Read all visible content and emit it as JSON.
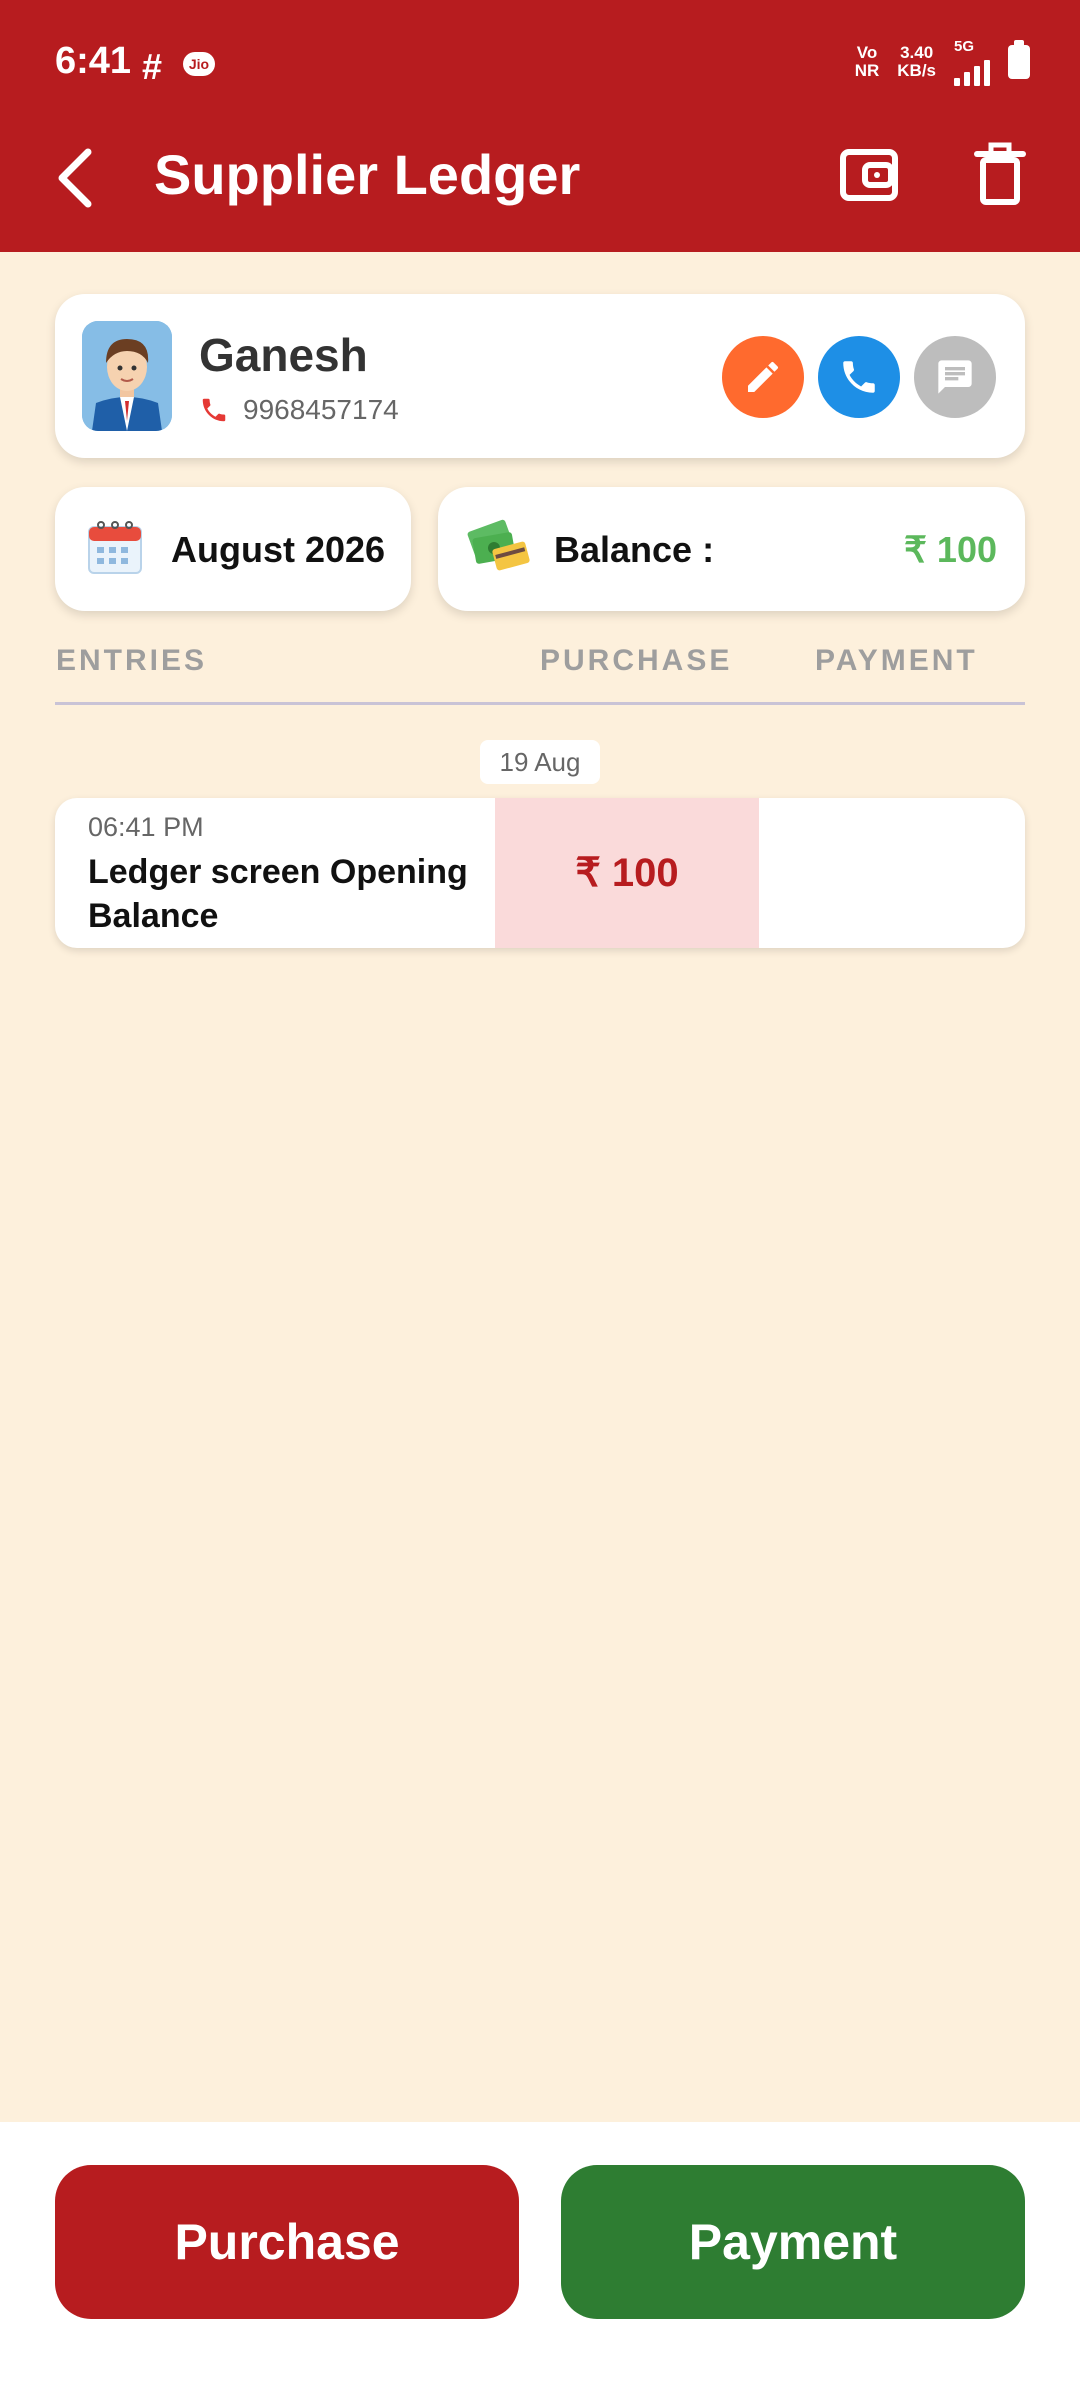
{
  "status_bar": {
    "time": "6:41",
    "slack_glyph": "#",
    "carrier_badge": "Jio",
    "volte_top": "Vo",
    "volte_bottom": "NR",
    "speed_top": "3.40",
    "speed_bottom": "KB/s",
    "network": "5G"
  },
  "app_bar": {
    "title": "Supplier Ledger",
    "back_icon": "back-arrow-icon",
    "actions": [
      "wallet-icon",
      "trash-icon"
    ],
    "color": "#B71C1F"
  },
  "contact": {
    "name": "Ganesh",
    "phone": "9968457174",
    "actions": [
      "edit-icon",
      "call-icon",
      "message-icon"
    ]
  },
  "summary": {
    "month": "August 2026",
    "balance_label": "Balance :",
    "balance_value": "₹ 100",
    "balance_color": "#5CB85C"
  },
  "columns": {
    "entries": "ENTRIES",
    "purchase": "PURCHASE",
    "payment": "PAYMENT"
  },
  "date_group": "19 Aug",
  "entry": {
    "time": "06:41 PM",
    "description": "Ledger screen Opening Balance",
    "purchase": "₹ 100",
    "payment": ""
  },
  "buttons": {
    "purchase": "Purchase",
    "payment": "Payment",
    "purchase_color": "#B71C1F",
    "payment_color": "#2E7D32"
  }
}
